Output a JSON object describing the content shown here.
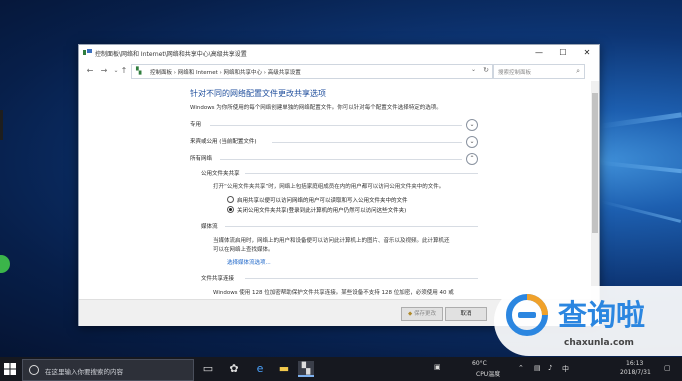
{
  "window": {
    "title": "控制面板\\网络和 Internet\\网络和共享中心\\高级共享设置",
    "breadcrumbs": [
      "控制面板",
      "网络和 Internet",
      "网络和共享中心",
      "高级共享设置"
    ],
    "crumb_sep": "›",
    "search_placeholder": "搜索控制面板",
    "heading": "针对不同的网络配置文件更改共享选项",
    "description": "Windows 为你所使用的每个网络创建单独的网络配置文件。你可以针对每个配置文件选择特定的选项。",
    "sections": [
      {
        "label": "专用",
        "state": "collapsed"
      },
      {
        "label": "来宾或公用 (当前配置文件)",
        "state": "collapsed"
      },
      {
        "label": "所有网络",
        "state": "expanded"
      }
    ],
    "public_folder": {
      "label": "公用文件夹共享",
      "text": "打开“公用文件夹共享”时，网络上包括家庭组成员在内的用户都可以访问公用文件夹中的文件。",
      "options": [
        {
          "label": "启用共享以便可以访问网络的用户可以读取和写入公用文件夹中的文件",
          "selected": false
        },
        {
          "label": "关闭公用文件夹共享(登录到此计算机的用户仍然可以访问这些文件夹)",
          "selected": true
        }
      ]
    },
    "media": {
      "label": "媒体流",
      "text1": "当媒体流启用时，网络上的用户和设备便可以访问此计算机上的图片、音乐以及视频。此计算机还",
      "text2": "可以在网络上查找媒体。",
      "link": "选择媒体流选项..."
    },
    "file_sharing": {
      "label": "文件共享连接",
      "text": "Windows 使用 128 位加密帮助保护文件共享连接。某些设备不支持 128 位加密，必须使用 40 或"
    },
    "buttons": {
      "save": "保存更改",
      "cancel": "取消"
    }
  },
  "taskbar": {
    "search_placeholder": "在这里输入你要搜索的内容",
    "temp": "60°C",
    "temp_label": "CPU温度",
    "time": "16:13",
    "date": "2018/7/31"
  },
  "watermark": {
    "brand": "查询啦",
    "url": "chaxunla.com"
  },
  "colors": {
    "heading": "#1f4e9c",
    "link": "#1a64c8",
    "brand": "#2b86e0"
  }
}
